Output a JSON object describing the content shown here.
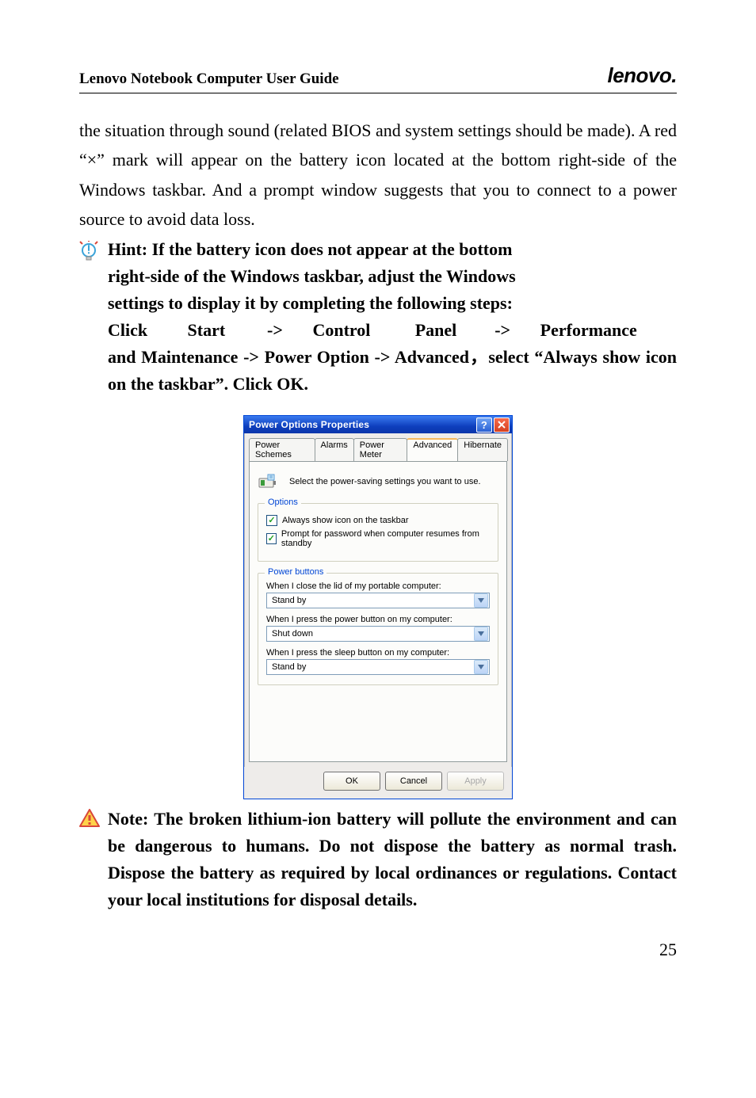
{
  "header": {
    "title": "Lenovo Notebook Computer User Guide",
    "logo": "lenovo."
  },
  "body": {
    "paragraph": "the situation through sound (related BIOS and system settings should be made). A red “×” mark will appear on the battery icon located at the bottom right-side of the Windows taskbar. And a prompt window suggests that you to connect to a power source to avoid data loss."
  },
  "hint": {
    "line1": "Hint: If the battery icon does not appear at the bottom",
    "line2": "right-side of the Windows taskbar, adjust the Windows",
    "line3": "settings to display it by completing the following steps:",
    "line4": "Click Start -> Control Panel -> Performance and Maintenance -> Power Option -> Advanced，select “Always show icon on the taskbar”. Click OK."
  },
  "dialog": {
    "title": "Power Options Properties",
    "tabs": {
      "schemes": "Power Schemes",
      "alarms": "Alarms",
      "meter": "Power Meter",
      "advanced": "Advanced",
      "hibernate": "Hibernate"
    },
    "desc": "Select the power-saving settings you want to use.",
    "options": {
      "legend": "Options",
      "chk1": "Always show icon on the taskbar",
      "chk2": "Prompt for password when computer resumes from standby"
    },
    "power_buttons": {
      "legend": "Power buttons",
      "label1": "When I close the lid of my portable computer:",
      "value1": "Stand by",
      "label2": "When I press the power button on my computer:",
      "value2": "Shut down",
      "label3": "When I press the sleep button on my computer:",
      "value3": "Stand by"
    },
    "buttons": {
      "ok": "OK",
      "cancel": "Cancel",
      "apply": "Apply"
    }
  },
  "note": {
    "text": "Note: The broken lithium-ion battery will pollute the environment and can be dangerous to humans. Do not dispose the battery as normal trash. Dispose the battery as required by local ordinances or regulations. Contact your local institutions for disposal details."
  },
  "page_number": "25"
}
